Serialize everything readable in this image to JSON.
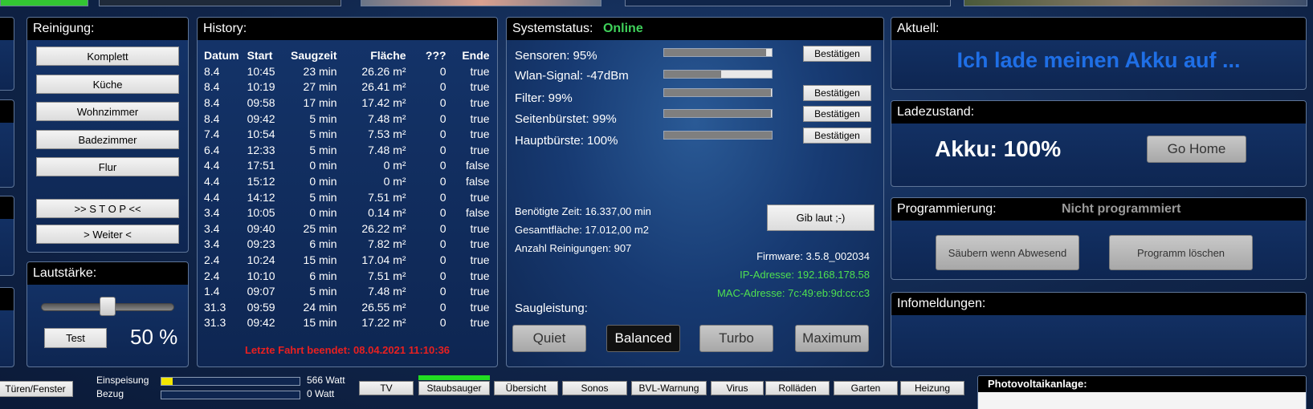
{
  "reinigung": {
    "title": "Reinigung:",
    "buttons": [
      "Komplett",
      "Küche",
      "Wohnzimmer",
      "Badezimmer",
      "Flur"
    ],
    "stop_label": ">> S T O P <<",
    "weiter_label": "> Weiter <"
  },
  "lautstaerke": {
    "title": "Lautstärke:",
    "test_label": "Test",
    "value": "50 %",
    "level": 0.5
  },
  "history": {
    "title": "History:",
    "columns": [
      "Datum",
      "Start",
      "Saugzeit",
      "Fläche",
      "???",
      "Ende"
    ],
    "rows": [
      [
        "8.4",
        "10:45",
        "23 min",
        "26.26 m²",
        "0",
        "true"
      ],
      [
        "8.4",
        "10:19",
        "27 min",
        "26.41 m²",
        "0",
        "true"
      ],
      [
        "8.4",
        "09:58",
        "17 min",
        "17.42 m²",
        "0",
        "true"
      ],
      [
        "8.4",
        "09:42",
        "5 min",
        "7.48 m²",
        "0",
        "true"
      ],
      [
        "7.4",
        "10:54",
        "5 min",
        "7.53 m²",
        "0",
        "true"
      ],
      [
        "6.4",
        "12:33",
        "5 min",
        "7.48 m²",
        "0",
        "true"
      ],
      [
        "4.4",
        "17:51",
        "0 min",
        "0 m²",
        "0",
        "false"
      ],
      [
        "4.4",
        "15:12",
        "0 min",
        "0 m²",
        "0",
        "false"
      ],
      [
        "4.4",
        "14:12",
        "5 min",
        "7.51 m²",
        "0",
        "true"
      ],
      [
        "3.4",
        "10:05",
        "0 min",
        "0.14 m²",
        "0",
        "false"
      ],
      [
        "3.4",
        "09:40",
        "25 min",
        "26.22 m²",
        "0",
        "true"
      ],
      [
        "3.4",
        "09:23",
        "6 min",
        "7.82 m²",
        "0",
        "true"
      ],
      [
        "2.4",
        "10:24",
        "15 min",
        "17.04 m²",
        "0",
        "true"
      ],
      [
        "2.4",
        "10:10",
        "6 min",
        "7.51 m²",
        "0",
        "true"
      ],
      [
        "1.4",
        "09:07",
        "5 min",
        "7.48 m²",
        "0",
        "true"
      ],
      [
        "31.3",
        "09:59",
        "24 min",
        "26.55 m²",
        "0",
        "true"
      ],
      [
        "31.3",
        "09:42",
        "15 min",
        "17.22 m²",
        "0",
        "true"
      ]
    ],
    "last_run": "Letzte Fahrt beendet: 08.04.2021 11:10:36"
  },
  "systemstatus": {
    "title": "Systemstatus:",
    "status": "Online",
    "sensors": [
      {
        "label": "Sensoren: 95%",
        "level": 0.95,
        "confirm": "Bestätigen"
      },
      {
        "label": "Wlan-Signal: -47dBm",
        "level": 0.53,
        "confirm": ""
      },
      {
        "label": "Filter: 99%",
        "level": 0.99,
        "confirm": "Bestätigen"
      },
      {
        "label": "Seitenbürstet: 99%",
        "level": 0.99,
        "confirm": "Bestätigen"
      },
      {
        "label": "Hauptbürste: 100%",
        "level": 1.0,
        "confirm": "Bestätigen"
      }
    ],
    "time_needed": "Benötigte Zeit: 16.337,00 min",
    "total_area": "Gesamtfläche: 17.012,00 m2",
    "cleanings": "Anzahl Reinigungen: 907",
    "gib_laut_label": "Gib laut ;-)",
    "firmware": "Firmware: 3.5.8_002034",
    "ip": "IP-Adresse: 192.168.178.58",
    "mac": "MAC-Adresse: 7c:49:eb:9d:cc:c3",
    "saugleistung_label": "Saugleistung:",
    "modes": [
      "Quiet",
      "Balanced",
      "Turbo",
      "Maximum"
    ],
    "active_mode": "Balanced"
  },
  "aktuell": {
    "title": "Aktuell:",
    "message": "Ich lade meinen Akku auf ..."
  },
  "ladezustand": {
    "title": "Ladezustand:",
    "akku": "Akku: 100%",
    "go_home_label": "Go Home"
  },
  "programmierung": {
    "title": "Programmierung:",
    "status": "Nicht programmiert",
    "saeubern_label": "Säubern wenn Abwesend",
    "loeschen_label": "Programm löschen"
  },
  "infomeldungen": {
    "title": "Infomeldungen:"
  },
  "bottom": {
    "tueren_label": "Türen/Fenster",
    "einspeisung_label": "Einspeisung",
    "einspeisung_value": "566 Watt",
    "einspeisung_level": 0.08,
    "bezug_label": "Bezug",
    "bezug_value": "0 Watt",
    "bezug_level": 0.0,
    "tabs": [
      "TV",
      "Staubsauger",
      "Übersicht",
      "Sonos",
      "BVL-Warnung",
      "Virus",
      "Rolläden",
      "Garten",
      "Heizung"
    ],
    "active_tab": "Staubsauger",
    "photovoltaik_title": "Photovoltaikanlage:"
  },
  "colors": {
    "online": "#3fd15a",
    "aktuell_text": "#1f6fe6",
    "ip_mac": "#4fe04f",
    "last_run": "#e82020",
    "einspeisung_fill": "#f3e600",
    "active_tab_bar": "#22dd22"
  }
}
